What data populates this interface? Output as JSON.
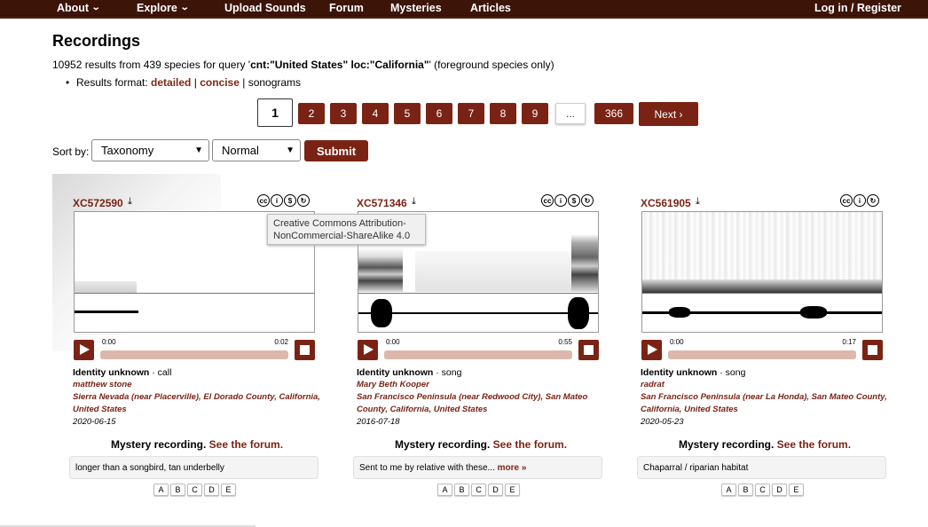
{
  "nav": {
    "about": "About",
    "explore": "Explore",
    "upload": "Upload Sounds",
    "forum": "Forum",
    "mysteries": "Mysteries",
    "articles": "Articles",
    "login": "Log in / Register"
  },
  "page_title": "Recordings",
  "summary": {
    "prefix": "10952 results from 439 species for query '",
    "query": "cnt:\"United States\" loc:\"California\"",
    "suffix": "' (foreground species only)"
  },
  "format": {
    "label": "Results format: ",
    "detailed": "detailed",
    "sep1": " | ",
    "concise": "concise",
    "sep2": " | ",
    "sonograms": "sonograms"
  },
  "pagination": {
    "current": "1",
    "pages": [
      "2",
      "3",
      "4",
      "5",
      "6",
      "7",
      "8",
      "9"
    ],
    "ellipsis": "...",
    "last": "366",
    "next": "Next"
  },
  "sort": {
    "label": "Sort by:",
    "field": "Taxonomy",
    "order": "Normal",
    "submit": "Submit"
  },
  "tooltip": "Creative Commons Attribution-NonCommercial-ShareAlike 4.0",
  "cards": [
    {
      "id": "XC572590",
      "t_start": "0:00",
      "t_end": "0:02",
      "identity": "Identity unknown",
      "type": " · call",
      "recordist": "matthew stone",
      "location": "Sierra Nevada (near Placerville), El Dorado County, California, United States",
      "date": "2020-06-15",
      "mystery_text": "Mystery recording.",
      "mystery_link": "See the forum.",
      "remark": "longer than a songbird, tan underbelly",
      "more": "",
      "votes": [
        "A",
        "B",
        "C",
        "D",
        "E"
      ]
    },
    {
      "id": "XC571346",
      "t_start": "0:00",
      "t_end": "0:55",
      "identity": "Identity unknown",
      "type": " · song",
      "recordist": "Mary Beth Kooper",
      "location": "San Francisco Peninsula (near Redwood City), San Mateo County, California, United States",
      "date": "2016-07-18",
      "mystery_text": "Mystery recording.",
      "mystery_link": "See the forum.",
      "remark": "Sent to me by relative with these... ",
      "more": "more »",
      "votes": [
        "A",
        "B",
        "C",
        "D",
        "E"
      ]
    },
    {
      "id": "XC561905",
      "t_start": "0:00",
      "t_end": "0:17",
      "identity": "Identity unknown",
      "type": " · song",
      "recordist": "radrat",
      "location": "San Francisco Peninsula (near La Honda), San Mateo County, California, United States",
      "date": "2020-05-23",
      "mystery_text": "Mystery recording.",
      "mystery_link": "See the forum.",
      "remark": "Chaparral / riparian habitat",
      "more": "",
      "votes": [
        "A",
        "B",
        "C",
        "D",
        "E"
      ]
    }
  ]
}
